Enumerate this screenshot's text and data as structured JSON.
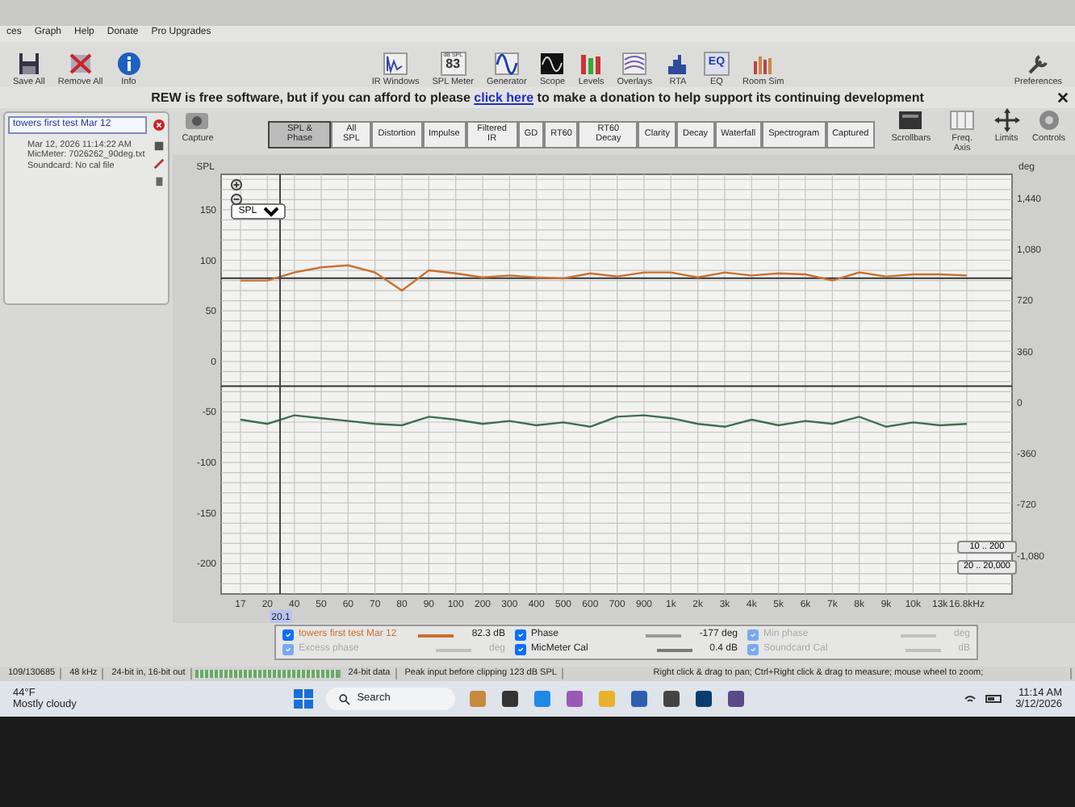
{
  "menu": [
    "ces",
    "Graph",
    "Help",
    "Donate",
    "Pro Upgrades"
  ],
  "toolbar_left": [
    {
      "label": "Save All",
      "kind": "save"
    },
    {
      "label": "Remove All",
      "kind": "remove"
    },
    {
      "label": "Info",
      "kind": "info"
    }
  ],
  "toolbar_center": [
    {
      "label": "IR Windows",
      "kind": "ir"
    },
    {
      "label": "SPL Meter",
      "kind": "meter",
      "meter_unit": "dB SPL",
      "meter_value": "83"
    },
    {
      "label": "Generator",
      "kind": "generator"
    },
    {
      "label": "Scope",
      "kind": "scope"
    },
    {
      "label": "Levels",
      "kind": "levels"
    },
    {
      "label": "Overlays",
      "kind": "overlays"
    },
    {
      "label": "RTA",
      "kind": "rta"
    },
    {
      "label": "EQ",
      "kind": "eq",
      "icon_text": "EQ"
    },
    {
      "label": "Room Sim",
      "kind": "roomsim"
    }
  ],
  "preferences": {
    "label": "Preferences"
  },
  "banner": {
    "before": "REW is free software, but if you can afford to please",
    "link": "click here",
    "after": "to make a donation to help support its continuing development"
  },
  "measurement": {
    "name": "towers first test Mar 12",
    "details": [
      "Mar 12, 2026 11:14:22 AM",
      "MicMeter: 7026262_90deg.txt",
      "Soundcard: No cal file"
    ]
  },
  "capture": {
    "label": "Capture",
    "unit": "SPL"
  },
  "tabs": [
    {
      "label": "SPL & Phase",
      "selected": true
    },
    {
      "label": "All SPL",
      "selected": false
    },
    {
      "label": "Distortion",
      "selected": false
    },
    {
      "label": "Impulse",
      "selected": false
    },
    {
      "label": "Filtered IR",
      "selected": false
    },
    {
      "label": "GD",
      "selected": false
    },
    {
      "label": "RT60",
      "selected": false
    },
    {
      "label": "RT60 Decay",
      "selected": false
    },
    {
      "label": "Clarity",
      "selected": false
    },
    {
      "label": "Decay",
      "selected": false
    },
    {
      "label": "Waterfall",
      "selected": false
    },
    {
      "label": "Spectrogram",
      "selected": false
    },
    {
      "label": "Captured",
      "selected": false
    }
  ],
  "graph_controls": [
    {
      "label": "Scrollbars",
      "kind": "scrollbars"
    },
    {
      "label": "Freq. Axis",
      "kind": "freqaxis"
    },
    {
      "label": "Limits",
      "kind": "limits"
    },
    {
      "label": "Controls",
      "kind": "controls"
    }
  ],
  "chart": {
    "unit_right": "deg",
    "dropdown": "SPL",
    "cursor_label": "20.1",
    "range_buttons": [
      "10 .. 200",
      "20 .. 20,000"
    ],
    "chart_data": {
      "type": "line",
      "grid": true,
      "ref_lines": [
        {
          "axis": "y",
          "value": 82.3
        },
        {
          "axis": "y2",
          "value": 116
        }
      ],
      "categories": [
        "17",
        "20",
        "40",
        "50",
        "60",
        "70",
        "80",
        "90",
        "100",
        "200",
        "300",
        "400",
        "500",
        "600",
        "700",
        "900",
        "1k",
        "2k",
        "3k",
        "4k",
        "5k",
        "6k",
        "7k",
        "8k",
        "9k",
        "10k",
        "13k",
        "16.8kHz"
      ],
      "ylim": [
        -230,
        185
      ],
      "yticks": [
        150,
        100,
        50,
        0,
        -50,
        -100,
        -150,
        -200
      ],
      "y2lim": [
        -1350,
        1610
      ],
      "y2ticks": [
        {
          "value": 1440,
          "label": "1,440"
        },
        {
          "value": 1080,
          "label": "1,080"
        },
        720,
        360,
        0,
        -360,
        -720,
        {
          "value": -1080,
          "label": "-1,080"
        }
      ],
      "series": [
        {
          "name": "towers first test Mar 12",
          "color": "#c8702e",
          "values": [
            80,
            80,
            88,
            93,
            95,
            88,
            70,
            90,
            87,
            83,
            85,
            83,
            82,
            87,
            84,
            88,
            88,
            83,
            88,
            85,
            87,
            86,
            80,
            88,
            84,
            86,
            86,
            85
          ]
        },
        {
          "name": "Phase",
          "color": "#3f6e52",
          "axis": "y2",
          "values": [
            -120,
            -150,
            -90,
            -110,
            -130,
            -150,
            -160,
            -100,
            -120,
            -150,
            -130,
            -160,
            -140,
            -170,
            -100,
            -90,
            -110,
            -150,
            -170,
            -120,
            -160,
            -130,
            -150,
            -100,
            -170,
            -140,
            -160,
            -150
          ]
        }
      ]
    }
  },
  "legend": [
    {
      "kind": "series",
      "checked": true,
      "disabled": false,
      "color": "#c8702e",
      "reading": "82.3 dB"
    },
    {
      "kind": "series",
      "checked": true,
      "disabled": false,
      "color": "#9a9a9a",
      "reading": "-177 deg"
    },
    {
      "label": "Min phase",
      "checked": true,
      "disabled": true,
      "color": "#c0c0c0",
      "reading": "deg"
    },
    {
      "label": "Excess phase",
      "checked": true,
      "disabled": true,
      "color": "#c0c0c0",
      "reading": "deg"
    },
    {
      "label": "MicMeter Cal",
      "checked": true,
      "disabled": false,
      "color": "#7a7a7a",
      "reading": "0.4 dB"
    },
    {
      "label": "Soundcard Cal",
      "checked": true,
      "disabled": true,
      "color": "#c0c0c0",
      "reading": "dB"
    }
  ],
  "status_bar": [
    "109/130685",
    "48 kHz",
    "24-bit in, 16-bit out",
    "24-bit data",
    "Peak input before clipping 123 dB SPL",
    "Right click & drag to pan; Ctrl+Right click & drag to measure; mouse wheel to zoom;"
  ],
  "taskbar": {
    "temperature": "44°F",
    "weather": "Mostly cloudy",
    "search": "Search",
    "time": "11:14 AM",
    "date": "3/12/2026"
  }
}
